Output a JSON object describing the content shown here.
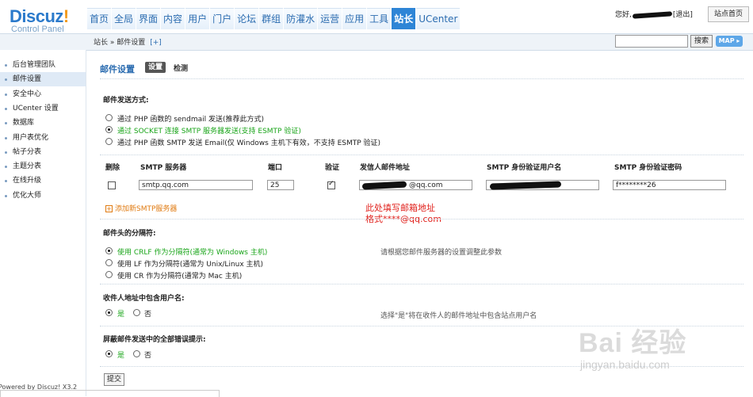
{
  "header": {
    "logo_text": "Discuz",
    "logo_bang": "!",
    "logo_sub": "Control Panel",
    "nav_tabs": [
      "首页",
      "全局",
      "界面",
      "内容",
      "用户",
      "门户",
      "论坛",
      "群组",
      "防灌水",
      "运营",
      "应用",
      "工具",
      "站长",
      "UCenter"
    ],
    "active_tab": "站长",
    "greeting": "您好,",
    "logout": "[退出]",
    "site_home": "站点首页"
  },
  "subbar": {
    "breadcrumb": "站长 » 邮件设置",
    "add": "[+]",
    "search_button": "搜索",
    "map_button": "MAP"
  },
  "sidebar": {
    "items": [
      "后台管理团队",
      "邮件设置",
      "安全中心",
      "UCenter 设置",
      "数据库",
      "用户表优化",
      "帖子分表",
      "主题分表",
      "在线升级",
      "优化大师"
    ],
    "active": "邮件设置",
    "powered": "Powered by Discuz! X3.2"
  },
  "main": {
    "title": "邮件设置",
    "tab_settings": "设置",
    "tab_check": "检测",
    "send_section": "邮件发送方式:",
    "send_options": [
      "通过 PHP 函数的 sendmail 发送(推荐此方式)",
      "通过 SOCKET 连接 SMTP 服务器发送(支持 ESMTP 验证)",
      "通过 PHP 函数 SMTP 发送 Email(仅 Windows 主机下有效，不支持 ESMTP 验证)"
    ],
    "send_selected": 1,
    "smtp_headers": [
      "删除",
      "SMTP 服务器",
      "端口",
      "验证",
      "发信人邮件地址",
      "SMTP 身份验证用户名",
      "SMTP 身份验证密码"
    ],
    "smtp_row": {
      "server": "smtp.qq.com",
      "port": "25",
      "auth": true,
      "from_email": "@qq.com",
      "password": "f********26"
    },
    "add_smtp": "添加新SMTP服务器",
    "annotation": [
      "此处填写邮箱地址",
      "格式****@qq.com"
    ],
    "separator_section": "邮件头的分隔符:",
    "separator_options": [
      "使用 CRLF 作为分隔符(通常为 Windows 主机)",
      "使用 LF 作为分隔符(通常为 Unix/Linux 主机)",
      "使用 CR 作为分隔符(通常为 Mac 主机)"
    ],
    "separator_selected": 0,
    "separator_hint": "请根据您邮件服务器的设置调整此参数",
    "include_user_section": "收件人地址中包含用户名:",
    "include_user_yes": "是",
    "include_user_no": "否",
    "include_user_hint": "选择\"是\"将在收件人的邮件地址中包含站点用户名",
    "silent_section": "屏蔽邮件发送中的全部错误提示:",
    "silent_yes": "是",
    "silent_no": "否",
    "submit": "提交"
  },
  "watermark": {
    "main": "Bai 经验",
    "sub": "jingyan.baidu.com"
  }
}
